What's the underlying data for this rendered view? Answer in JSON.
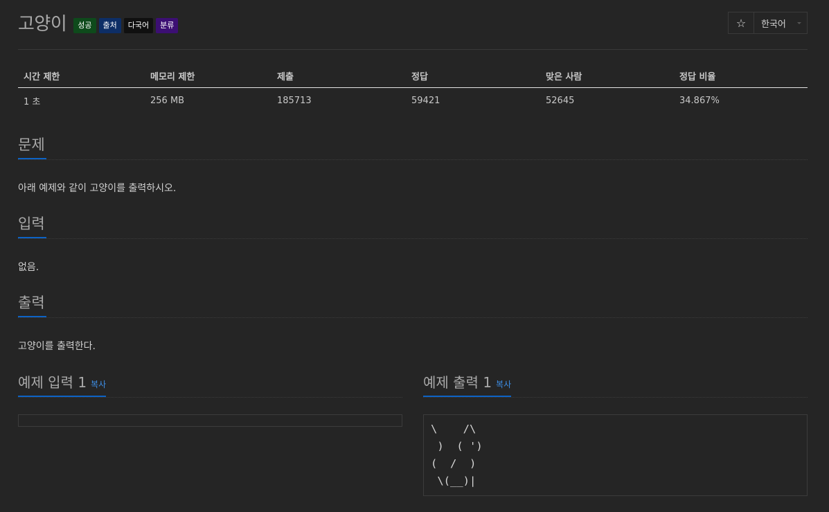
{
  "problem": {
    "title": "고양이",
    "badges": [
      {
        "label": "성공",
        "color": "#0e4a1b"
      },
      {
        "label": "출처",
        "color": "#0d2e66"
      },
      {
        "label": "다국어",
        "color": "#101010"
      },
      {
        "label": "분류",
        "color": "#3c0f73"
      }
    ]
  },
  "toolbar": {
    "star_icon": "star-icon",
    "star_glyph": "☆",
    "language": "한국어"
  },
  "info_table": {
    "headers": [
      "시간 제한",
      "메모리 제한",
      "제출",
      "정답",
      "맞은 사람",
      "정답 비율"
    ],
    "values": [
      "1 초",
      "256 MB",
      "185713",
      "59421",
      "52645",
      "34.867%"
    ]
  },
  "sections": {
    "problem": {
      "title": "문제",
      "text": "아래 예제와 같이 고양이를 출력하시오."
    },
    "input": {
      "title": "입력",
      "text": "없음."
    },
    "output": {
      "title": "출력",
      "text": "고양이를 출력한다."
    }
  },
  "samples": {
    "input": {
      "title": "예제 입력 1",
      "copy_label": "복사",
      "content": ""
    },
    "output": {
      "title": "예제 출력 1",
      "copy_label": "복사",
      "content": "\\    /\\\n )  ( ')\n(  /  )\n \\(__)|"
    }
  },
  "colors": {
    "background": "#252525",
    "accent": "#0d63c6",
    "link": "#3d8ee6"
  }
}
